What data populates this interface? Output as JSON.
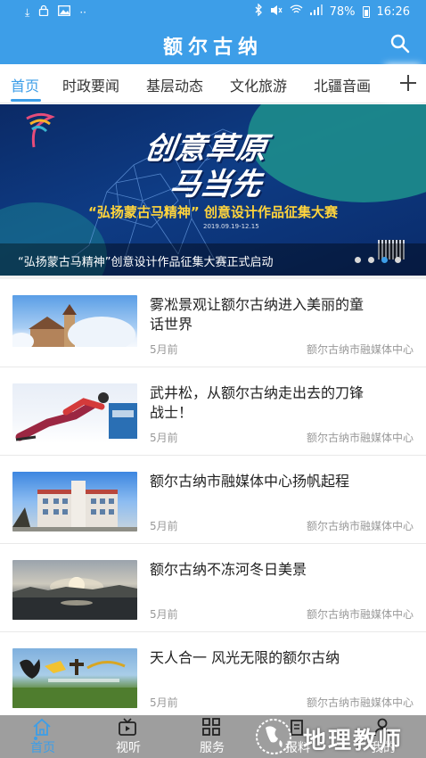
{
  "status_bar": {
    "battery": "78%",
    "time": "16:26",
    "left_icons": [
      "download-icon",
      "lock-icon",
      "image-icon",
      "more-icon"
    ],
    "right_icons": [
      "bluetooth-icon",
      "mute-icon",
      "wifi-icon",
      "signal-icon",
      "battery-icon"
    ]
  },
  "header": {
    "title": "额尔古纳",
    "accent": "#3d9ee8"
  },
  "tabs": [
    {
      "label": "首页",
      "active": true
    },
    {
      "label": "时政要闻",
      "active": false
    },
    {
      "label": "基层动态",
      "active": false
    },
    {
      "label": "文化旅游",
      "active": false
    },
    {
      "label": "北疆音画",
      "active": false
    }
  ],
  "banner": {
    "headline_line1": "创意草原",
    "headline_line2": "马当先",
    "subtitle": "“弘扬蒙古马精神” 创意设计作品征集大赛",
    "date": "2019.09.19-12.15",
    "caption": "“弘扬蒙古马精神”创意设计作品征集大赛正式启动",
    "slide_count": 4,
    "active_slide": 3
  },
  "news": [
    {
      "title": "雾凇景观让额尔古纳进入美丽的童话世界",
      "time": "5月前",
      "source": "额尔古纳市融媒体中心"
    },
    {
      "title": "武井松，从额尔古纳走出去的刀锋战士！",
      "time": "5月前",
      "source": "额尔古纳市融媒体中心"
    },
    {
      "title": "额尔古纳市融媒体中心扬帆起程",
      "time": "5月前",
      "source": "额尔古纳市融媒体中心"
    },
    {
      "title": "额尔古纳不冻河冬日美景",
      "time": "5月前",
      "source": "额尔古纳市融媒体中心"
    },
    {
      "title": "天人合一 风光无限的额尔古纳",
      "time": "5月前",
      "source": "额尔古纳市融媒体中心"
    }
  ],
  "bottom_nav": [
    {
      "label": "首页",
      "icon": "home-icon",
      "active": true
    },
    {
      "label": "视听",
      "icon": "video-icon",
      "active": false
    },
    {
      "label": "服务",
      "icon": "grid-icon",
      "active": false
    },
    {
      "label": "报料",
      "icon": "report-icon",
      "active": false
    },
    {
      "label": "我的",
      "icon": "user-icon",
      "active": false
    }
  ],
  "watermark": {
    "text": "地理教师"
  }
}
